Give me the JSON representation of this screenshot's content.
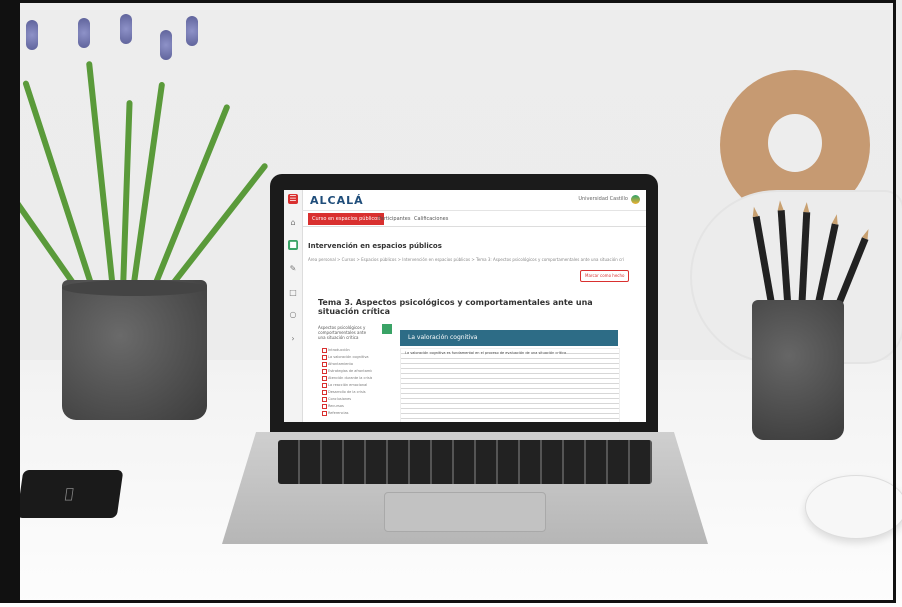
{
  "course": {
    "logo": "ALCALÁ",
    "user": "Universidad Castillo",
    "tabs": [
      "Curso en espacios públicos",
      "Participantes",
      "Calificaciones"
    ],
    "title": "Intervención en espacios públicos",
    "breadcrumb": "Área personal > Cursos > Espacios públicos > Intervención en espacios públicos > Tema 3: Aspectos psicológicos y comportamentales ante una situación crítica",
    "mark_done": "Marcar como hecho",
    "heading": "Tema 3. Aspectos psicológicos y comportamentales ante una situación crítica",
    "toc_intro": "Aspectos psicológicos y comportamentales ante una situación crítica",
    "toc_items": [
      "Introducción",
      "La valoración cognitiva",
      "Afrontamiento",
      "Estrategias de afrontamiento",
      "Atención durante la crisis",
      "La reacción emocional",
      "Desarrollo de la crisis",
      "Conclusiones",
      "Recursos",
      "Referencias"
    ],
    "section_title": "La valoración cognitiva",
    "body_snippet": "La valoración cognitiva es fundamental en el proceso de evaluación de una situación crítica"
  },
  "colors": {
    "accent": "#d9302f",
    "section": "#2d6c86",
    "green": "#3aa366"
  },
  "objects": [
    "flowering-plant",
    "wooden-ampersand",
    "pencil-holder",
    "smartphone",
    "mouse",
    "laptop"
  ]
}
